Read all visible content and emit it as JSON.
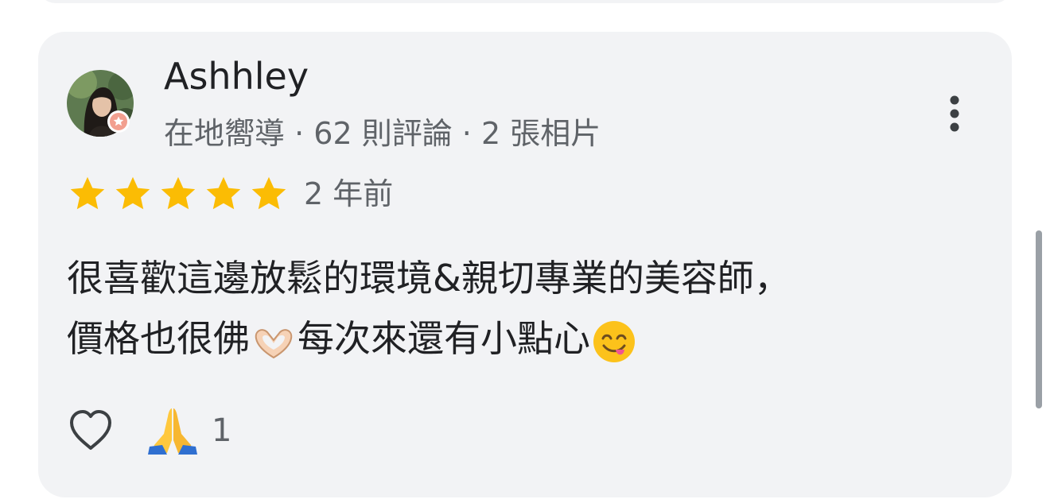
{
  "review": {
    "reviewer_name": "Ashhley",
    "reviewer_badge": "在地嚮導",
    "review_count": "62 則評論",
    "photo_count": "2 張相片",
    "separator": " · ",
    "rating": 5,
    "rating_max": 5,
    "date": "2 年前",
    "text_line_1": "很喜歡這邊放鬆的環境&親切專業的美容師，",
    "text_line_2_part_1": "價格也很佛",
    "text_line_2_part_2": "每次來還有小點心",
    "emoji_1": "heart-hands",
    "emoji_2": "face-savoring-food",
    "reaction_icon": "folded-hands",
    "reaction_count": "1"
  },
  "colors": {
    "card_bg": "#f2f3f5",
    "star": "#fbbc04",
    "primary_text": "#202124",
    "secondary_text": "#5f6368",
    "badge": "#f29f8f"
  }
}
